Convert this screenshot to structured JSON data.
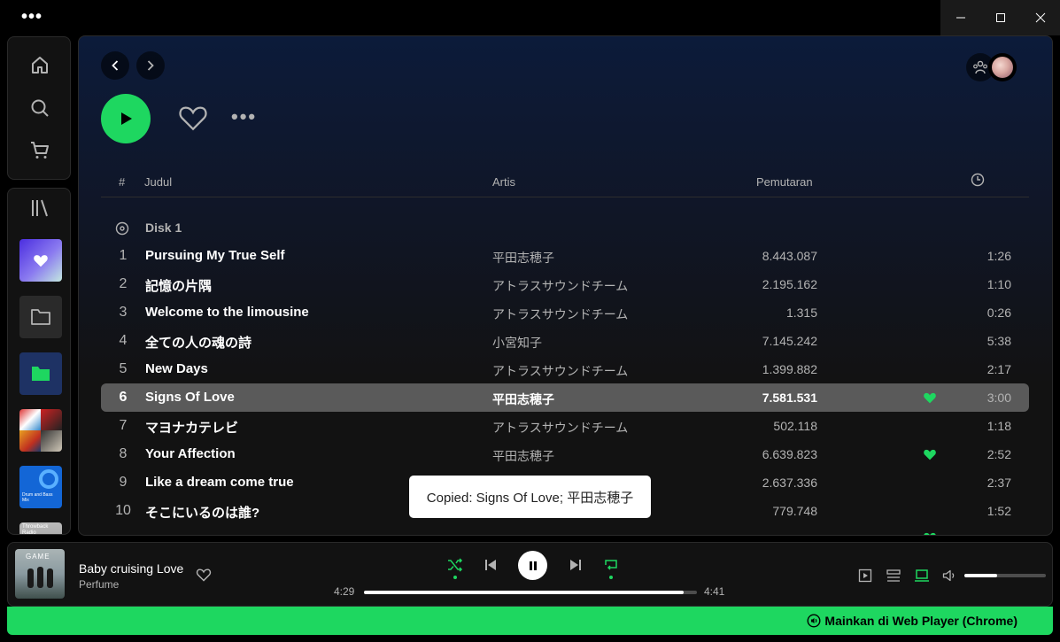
{
  "header": {
    "col_number": "#",
    "col_title": "Judul",
    "col_artist": "Artis",
    "col_plays": "Pemutaran"
  },
  "disk_label": "Disk 1",
  "tracks": [
    {
      "num": "1",
      "title": "Pursuing My True Self",
      "artist": "平田志穂子",
      "plays": "8.443.087",
      "duration": "1:26",
      "liked": false
    },
    {
      "num": "2",
      "title": "記憶の片隅",
      "artist": "アトラスサウンドチーム",
      "plays": "2.195.162",
      "duration": "1:10",
      "liked": false
    },
    {
      "num": "3",
      "title": "Welcome to the limousine",
      "artist": "アトラスサウンドチーム",
      "plays": "1.315",
      "duration": "0:26",
      "liked": false
    },
    {
      "num": "4",
      "title": "全ての人の魂の詩",
      "artist": "小宮知子",
      "plays": "7.145.242",
      "duration": "5:38",
      "liked": false
    },
    {
      "num": "5",
      "title": "New Days",
      "artist": "アトラスサウンドチーム",
      "plays": "1.399.882",
      "duration": "2:17",
      "liked": false
    },
    {
      "num": "6",
      "title": "Signs Of Love",
      "artist": "平田志穂子",
      "plays": "7.581.531",
      "duration": "3:00",
      "liked": true,
      "active": true
    },
    {
      "num": "7",
      "title": "マヨナカテレビ",
      "artist": "アトラスサウンドチーム",
      "plays": "502.118",
      "duration": "1:18",
      "liked": false
    },
    {
      "num": "8",
      "title": "Your Affection",
      "artist": "平田志穂子",
      "plays": "6.639.823",
      "duration": "2:52",
      "liked": true
    },
    {
      "num": "9",
      "title": "Like a dream come true",
      "artist": "",
      "plays": "2.637.336",
      "duration": "2:37",
      "liked": false
    },
    {
      "num": "10",
      "title": "そこにいるのは誰?",
      "artist": "",
      "plays": "779.748",
      "duration": "1:52",
      "liked": false
    }
  ],
  "toast": "Copied: Signs Of Love; 平田志穂子",
  "now_playing": {
    "title": "Baby cruising Love",
    "artist": "Perfume",
    "elapsed": "4:29",
    "total": "4:41",
    "progress": 0.96,
    "volume": 0.4
  },
  "library_thumbs": [
    "Drum and Bass Mix",
    "Throwback Radio"
  ],
  "bottom_banner": "Mainkan di Web Player (Chrome)",
  "colors": {
    "accent": "#1ed760",
    "active_row": "#5a5a5a",
    "background": "#121212"
  }
}
